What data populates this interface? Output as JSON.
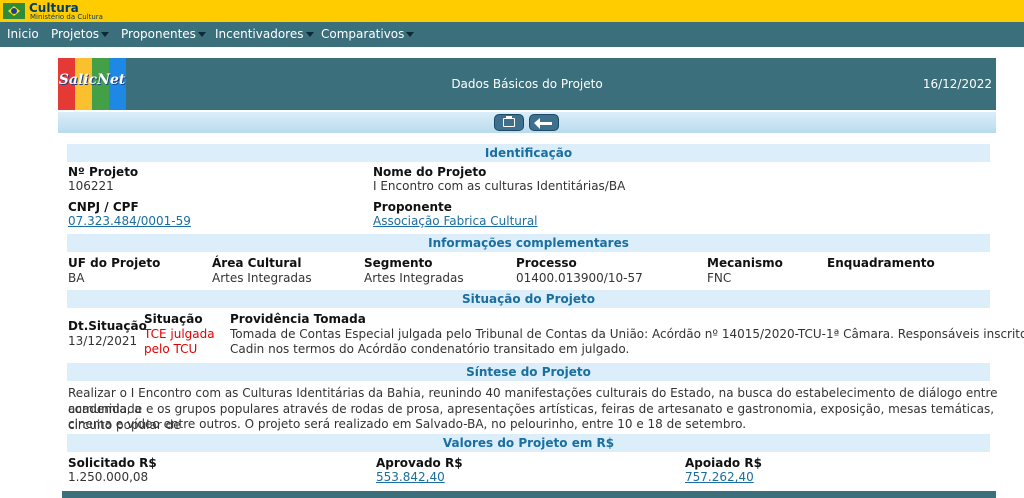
{
  "topbar": {
    "title": "Cultura",
    "subtitle": "Ministério da Cultura"
  },
  "nav": {
    "items": [
      "Inicio",
      "Projetos",
      "Proponentes",
      "Incentivadores",
      "Comparativos"
    ]
  },
  "header": {
    "logo_text": "SalicNet",
    "title": "Dados Básicos do Projeto",
    "date": "16/12/2022"
  },
  "sections": {
    "identificacao": "Identificação",
    "informacoes": "Informações complementares",
    "situacao": "Situação do Projeto",
    "sintese": "Síntese do Projeto",
    "valores": "Valores do Projeto em R$"
  },
  "identificacao": {
    "numero_label": "Nº Projeto",
    "numero_value": "106221",
    "nome_label": "Nome do Projeto",
    "nome_value": "I Encontro com as culturas Identitárias/BA",
    "cnpj_label": "CNPJ / CPF",
    "cnpj_value": "07.323.484/0001-59",
    "proponente_label": "Proponente",
    "proponente_value": "Associação Fabrica Cultural"
  },
  "informacoes": {
    "uf_label": "UF do Projeto",
    "uf_value": "BA",
    "area_label": "Área Cultural",
    "area_value": "Artes Integradas",
    "segmento_label": "Segmento",
    "segmento_value": "Artes Integradas",
    "processo_label": "Processo",
    "processo_value": "01400.013900/10-57",
    "mecanismo_label": "Mecanismo",
    "mecanismo_value": "FNC",
    "enquadramento_label": "Enquadramento",
    "enquadramento_value": ""
  },
  "situacao": {
    "dt_label": "Dt.Situação",
    "dt_value": "13/12/2021",
    "sit_label": "Situação",
    "sit_value_1": "TCE julgada",
    "sit_value_2": "pelo TCU",
    "prov_label": "Providência Tomada",
    "prov_line_1": "Tomada de Contas Especial julgada pelo Tribunal de Contas da União: Acórdão nº 14015/2020-TCU-1ª Câmara. Responsáveis inscritos no",
    "prov_line_2": "Cadin nos termos do Acórdão condenatório transitado em julgado."
  },
  "sintese": {
    "line_1": "Realizar o I Encontro com as Culturas Identitárias da Bahia, reunindo 40 manifestações culturais do Estado, na busca do estabelecimento de diálogo entre academia, a",
    "line_2": "comunidade e os grupos populares através de rodas de prosa, apresentações artísticas, feiras de artesanato e gastronomia, exposição, mesas temáticas, circuito popular de",
    "line_3": "cinema e vídeo entre outros. O projeto será realizado em Salvado-BA, no pelourinho, entre 10 e 18 de setembro."
  },
  "valores": {
    "solicitado_label": "Solicitado R$",
    "solicitado_value": "1.250.000,08",
    "aprovado_label": "Aprovado R$",
    "aprovado_value": "553.842,40",
    "apoiado_label": "Apoiado R$",
    "apoiado_value": "757.262,40"
  }
}
